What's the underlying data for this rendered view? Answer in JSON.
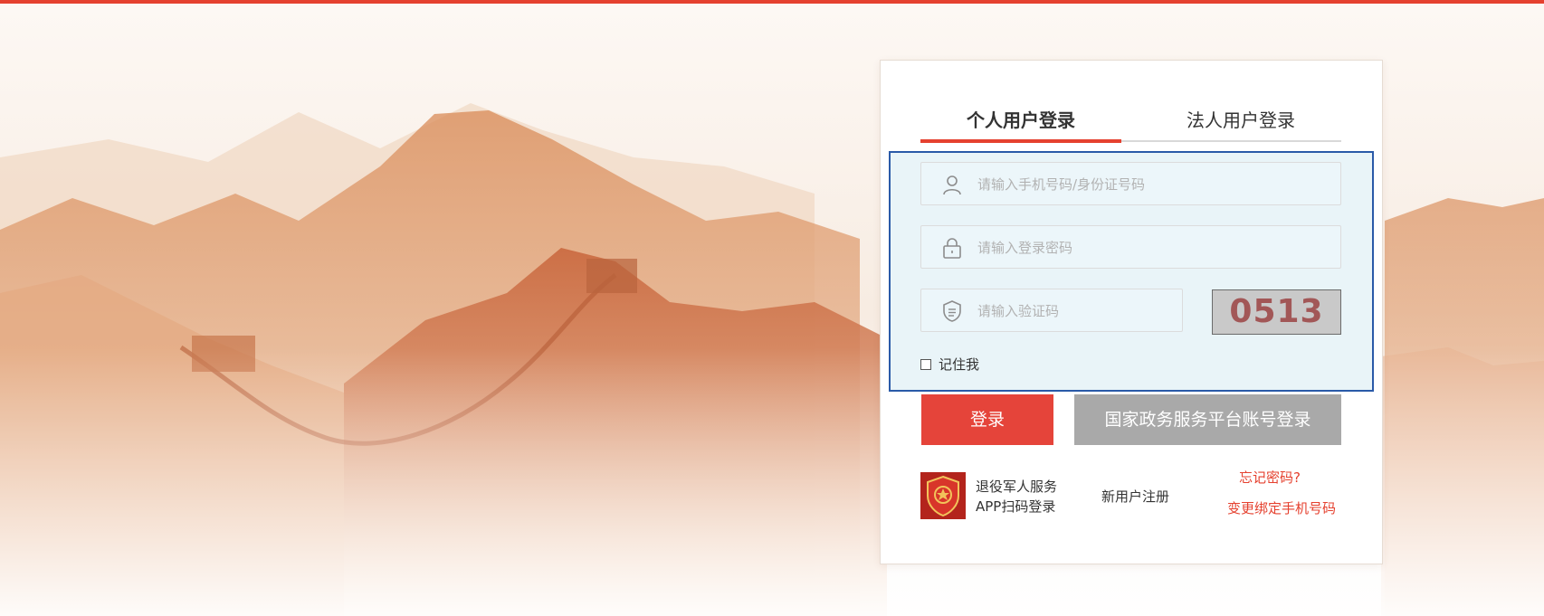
{
  "colors": {
    "accent": "#e5412f",
    "login_button": "#e5443a",
    "secondary_button": "#a9a9a9",
    "focus_border": "#2a5aa8"
  },
  "tabs": {
    "personal": "个人用户登录",
    "corporate": "法人用户登录",
    "active": "personal"
  },
  "form": {
    "account_placeholder": "请输入手机号码/身份证号码",
    "password_placeholder": "请输入登录密码",
    "code_placeholder": "请输入验证码",
    "captcha_text": "0513",
    "remember_label": "记住我",
    "remember_checked": false
  },
  "buttons": {
    "login": "登录",
    "gov_platform_login": "国家政务服务平台账号登录"
  },
  "footer": {
    "app_line1": "退役军人服务",
    "app_line2": "APP扫码登录",
    "register": "新用户注册",
    "forgot_password": "忘记密码?",
    "change_phone": "变更绑定手机号码"
  },
  "icons": {
    "account": "user-icon",
    "password": "lock-icon",
    "code": "shield-icon",
    "app_badge": "veterans-emblem-icon"
  }
}
